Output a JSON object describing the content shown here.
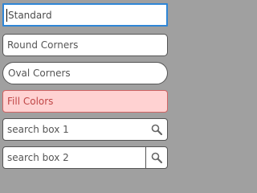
{
  "fields": {
    "standard": {
      "value": "Standard"
    },
    "round": {
      "value": "Round Corners"
    },
    "oval": {
      "value": "Oval Corners"
    },
    "fill": {
      "value": "Fill Colors"
    },
    "search1": {
      "placeholder": "search box 1",
      "icon": "search-icon"
    },
    "search2": {
      "placeholder": "search box 2",
      "icon": "search-icon"
    }
  },
  "colors": {
    "background": "#a0a0a0",
    "focus_border": "#2f86d6",
    "fill_background": "#ffd2d2",
    "fill_border": "#d06464",
    "fill_text": "#c04646"
  }
}
